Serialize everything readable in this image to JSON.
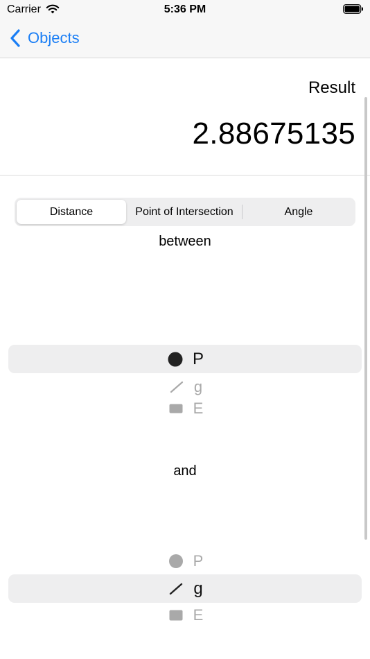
{
  "status": {
    "carrier": "Carrier",
    "time": "5:36 PM"
  },
  "nav": {
    "back_label": "Objects"
  },
  "result": {
    "label": "Result",
    "value": "2.88675135"
  },
  "segments": [
    {
      "label": "Distance",
      "selected": true
    },
    {
      "label": "Point of Intersection",
      "selected": false
    },
    {
      "label": "Angle",
      "selected": false
    }
  ],
  "between_label": "between",
  "and_label": "and",
  "picker1": {
    "selected": "P",
    "items": [
      {
        "icon": "point-icon",
        "label": "P"
      },
      {
        "icon": "line-icon",
        "label": "g"
      },
      {
        "icon": "plane-icon",
        "label": "E"
      }
    ]
  },
  "picker2": {
    "selected": "g",
    "items": [
      {
        "icon": "point-icon",
        "label": "P"
      },
      {
        "icon": "line-icon",
        "label": "g"
      },
      {
        "icon": "plane-icon",
        "label": "E"
      }
    ]
  }
}
